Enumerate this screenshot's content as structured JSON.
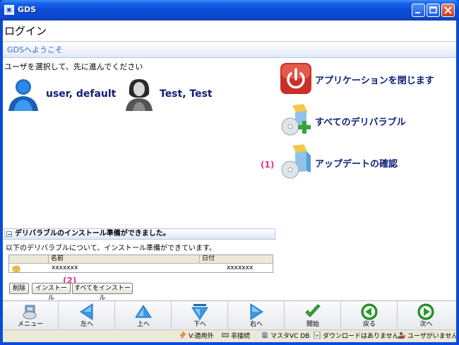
{
  "window": {
    "title": "GDS",
    "icon_name": "gds-app-icon",
    "buttons": [
      "minimize-button",
      "maximize-button",
      "close-button"
    ]
  },
  "page": {
    "heading": "ログイン",
    "welcome": "GDSへようこそ",
    "instruction": "ユーザを選択して、先に進んでください"
  },
  "users": [
    {
      "name": "user, default",
      "icon": "male-user-icon"
    },
    {
      "name": "Test, Test",
      "icon": "female-user-icon"
    }
  ],
  "actions": [
    {
      "label": "アプリケーションを閉じます",
      "icon": "power-icon"
    },
    {
      "label": "すべてのデリバラブル",
      "icon": "deliverable-add-icon"
    },
    {
      "label": "アップデートの確認",
      "icon": "deliverable-update-icon",
      "annotation": "(1)"
    }
  ],
  "install_panel": {
    "header": "デリバラブルのインストール準備ができました。",
    "collapse_glyph": "−",
    "description": "以下のデリバラブルについて、インストール準備ができています。",
    "columns": [
      "名前",
      "日付"
    ],
    "rows": [
      {
        "icon": "package-icon",
        "name": "xxxxxxx",
        "date": "xxxxxxx"
      }
    ],
    "buttons": {
      "delete": "削除",
      "install": "インストール",
      "install_all": "すべてをインストール"
    },
    "annotation": "(2)"
  },
  "toolbar": {
    "buttons": [
      {
        "label": "メニュー",
        "icon": "menu-icon"
      },
      {
        "label": "左へ",
        "icon": "arrow-left-icon"
      },
      {
        "label": "上へ",
        "icon": "arrow-up-icon"
      },
      {
        "label": "下へ",
        "icon": "arrow-down-icon"
      },
      {
        "label": "右へ",
        "icon": "arrow-right-icon"
      },
      {
        "label": "開始",
        "icon": "checkmark-icon"
      },
      {
        "label": "戻る",
        "icon": "back-icon"
      },
      {
        "label": "次へ",
        "icon": "next-icon"
      }
    ]
  },
  "statusbar": {
    "voltage": "V:適用外",
    "connection": "非接続",
    "database": "マスタVC DB",
    "download": "ダウンロードはありません。",
    "user": "ユーザがいません"
  },
  "colors": {
    "title_blue": "#0a4ad6",
    "link_navy": "#0d1e78",
    "annotation_pink": "#e2338e",
    "power_red": "#d23b2b",
    "nav_green": "#2e9d2e",
    "nav_blue": "#2f8fe0"
  }
}
